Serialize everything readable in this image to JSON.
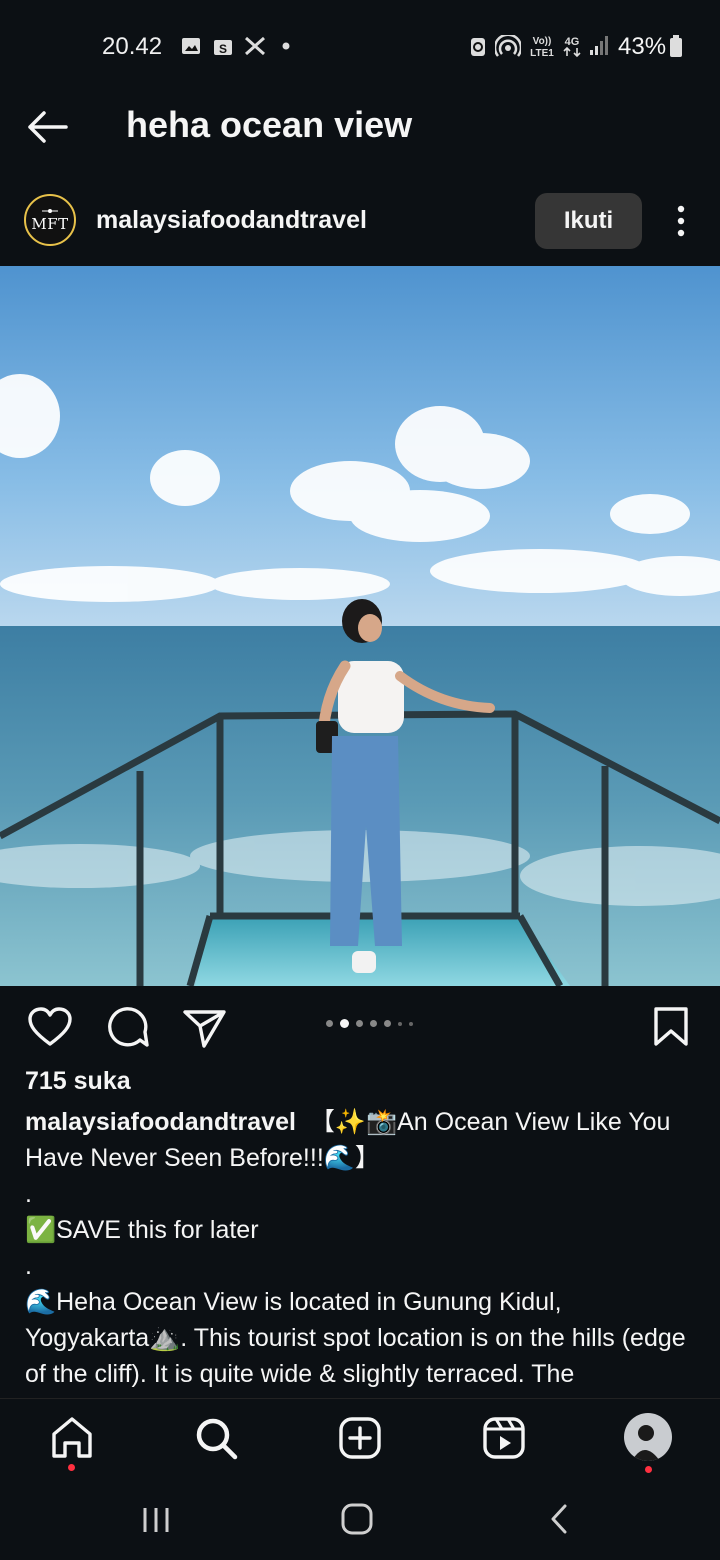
{
  "status_bar": {
    "time": "20.42",
    "battery": "43%",
    "network": "4G"
  },
  "header": {
    "title": "heha ocean view"
  },
  "post": {
    "avatar_text": "MFT",
    "username": "malaysiafoodandtravel",
    "follow_label": "Ikuti",
    "carousel": {
      "count": 7,
      "active_index": 1
    },
    "likes": "715 suka",
    "caption_lines": [
      "【✨📸An Ocean View Like You Have Never Seen Before!!!🌊】",
      ".",
      "✅SAVE this for later",
      ".",
      "🌊Heha Ocean View is located in Gunung Kidul, Yogyakarta⛰️. This tourist spot location is on the hills (edge of the cliff). It is quite wide & slightly terraced. The"
    ]
  },
  "icons": {
    "back": "arrow-left-icon",
    "more": "more-vertical-icon",
    "like": "heart-icon",
    "comment": "comment-icon",
    "share": "send-icon",
    "save": "bookmark-icon",
    "nav": [
      "home-icon",
      "search-icon",
      "create-icon",
      "reels-icon",
      "profile-avatar"
    ]
  },
  "colors": {
    "background": "#0c1014",
    "follow_button": "#363636",
    "notification": "#ff3040"
  }
}
